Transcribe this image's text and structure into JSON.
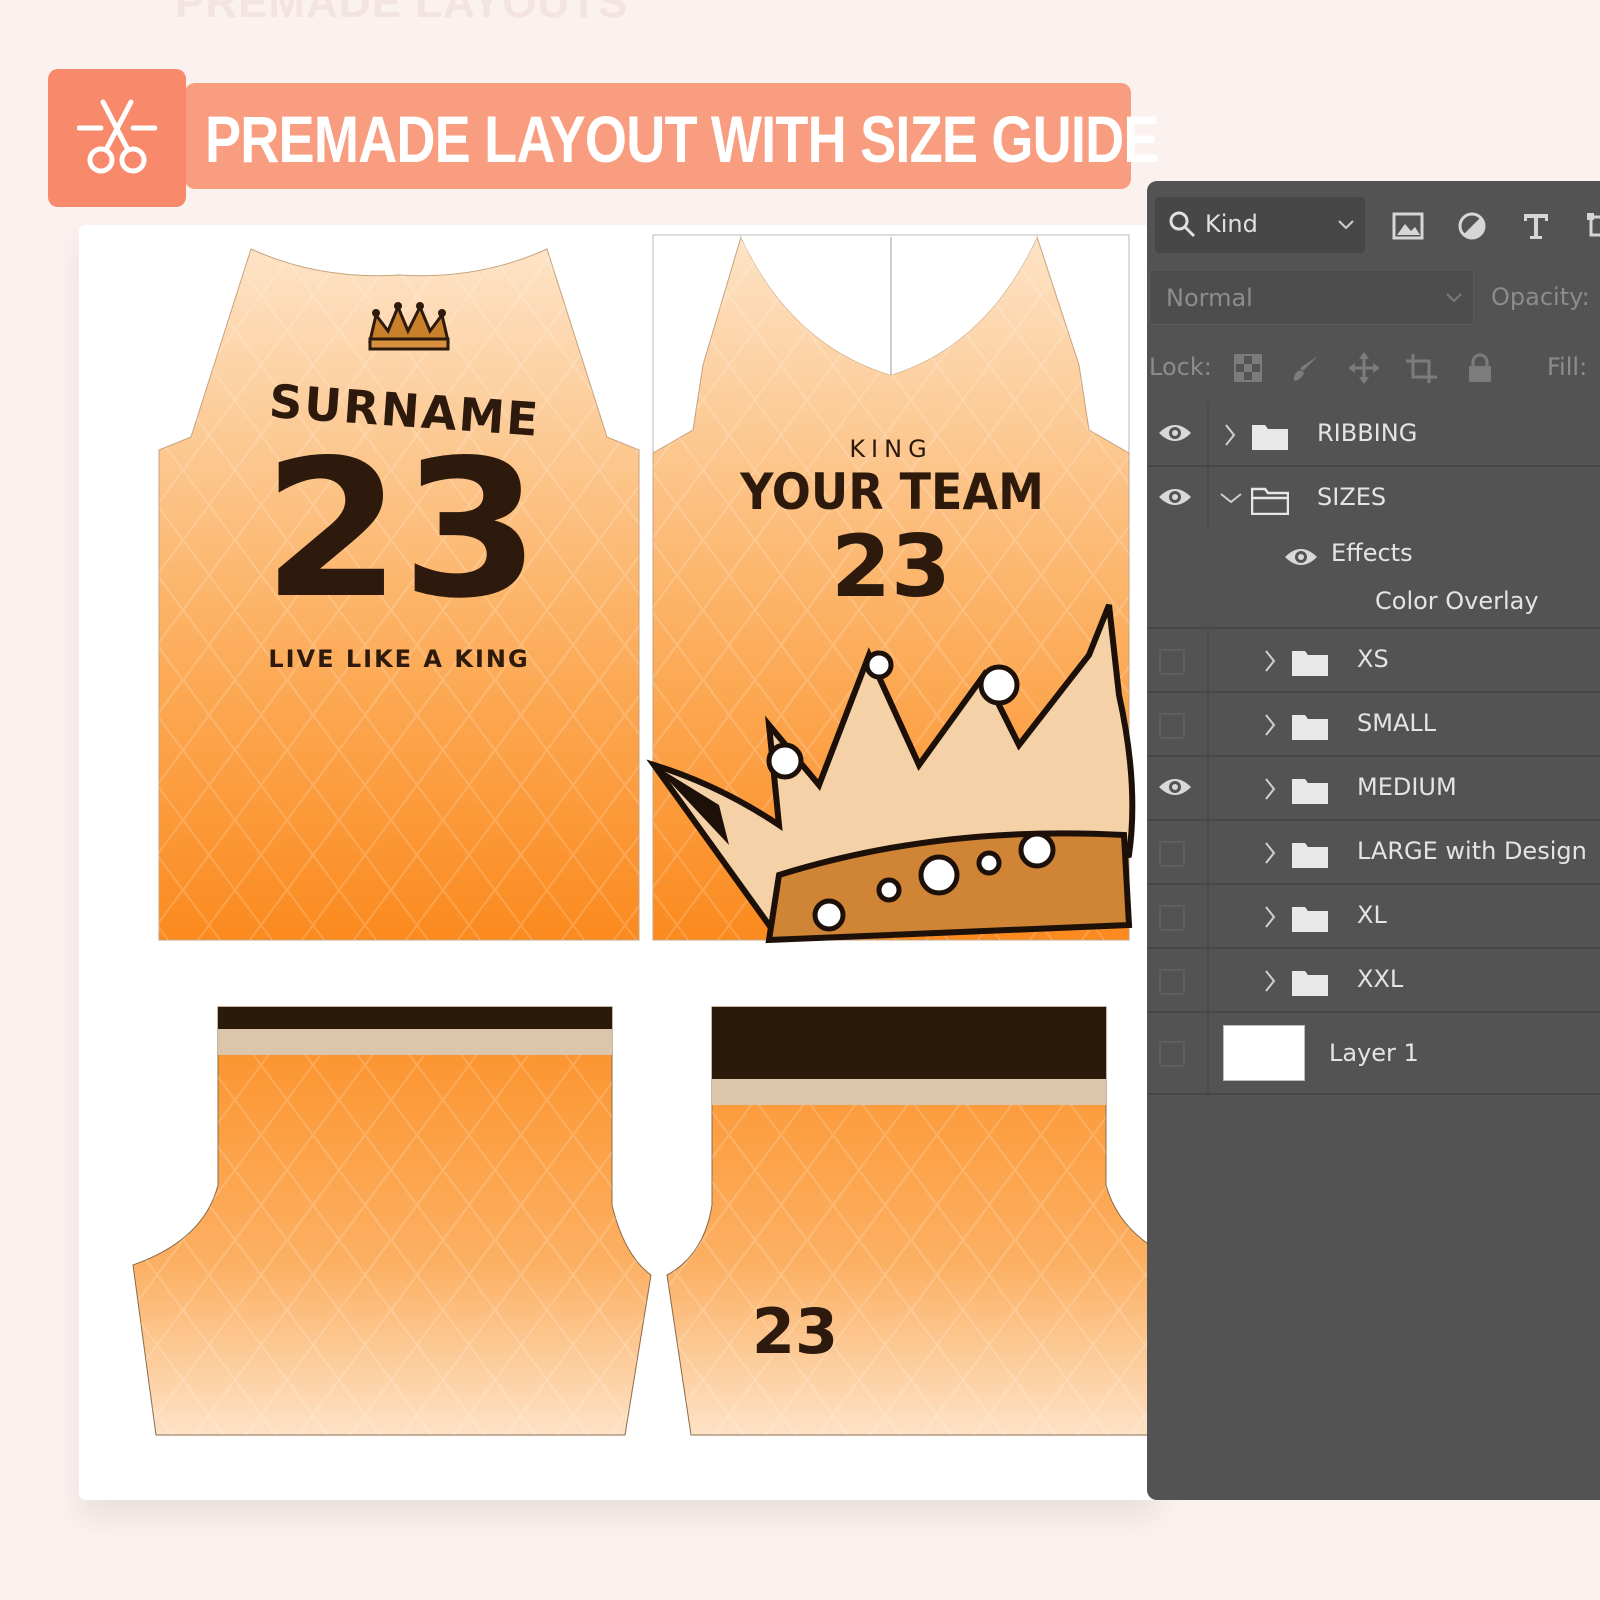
{
  "header": {
    "ghost_text": "PREMADE LAYOUTS",
    "banner_title": "PREMADE LAYOUT WITH SIZE GUIDE",
    "icon": "scissors-icon"
  },
  "colors": {
    "background": "#fbf1ef",
    "banner": "#f99d80",
    "banner_icon_box": "#f8896a",
    "jersey_light": "#fde3c6",
    "jersey_dark": "#fb8a1e",
    "brown": "#2d1a0c",
    "beige_stripe": "#dbc6ab",
    "panel": "#535353"
  },
  "jersey": {
    "back": {
      "surname": "SURNAME",
      "number": "23",
      "slogan": "LIVE LIKE A KING",
      "icon": "crown-icon"
    },
    "front": {
      "top_text": "KING",
      "team": "YOUR TEAM",
      "number": "23",
      "icon": "crown-icon"
    },
    "shorts": {
      "number": "23"
    }
  },
  "layers_panel": {
    "filter": {
      "kind_label": "Kind",
      "icons": [
        "image-filter-icon",
        "adjustment-filter-icon",
        "type-filter-icon",
        "shape-filter-icon"
      ]
    },
    "blend_mode": "Normal",
    "opacity_label": "Opacity:",
    "lock_label": "Lock:",
    "lock_icons": [
      "lock-transparent-icon",
      "lock-image-icon",
      "lock-position-icon",
      "lock-artboard-icon",
      "lock-all-icon"
    ],
    "fill_label": "Fill:",
    "layers": [
      {
        "name": "RIBBING",
        "visible": true,
        "expanded": false,
        "indent": 0,
        "type": "group"
      },
      {
        "name": "SIZES",
        "visible": true,
        "expanded": true,
        "indent": 0,
        "type": "group"
      },
      {
        "name": "XS",
        "visible": false,
        "expanded": false,
        "indent": 1,
        "type": "group"
      },
      {
        "name": "SMALL",
        "visible": false,
        "expanded": false,
        "indent": 1,
        "type": "group"
      },
      {
        "name": "MEDIUM",
        "visible": true,
        "expanded": false,
        "indent": 1,
        "type": "group"
      },
      {
        "name": "LARGE with Design",
        "visible": false,
        "expanded": false,
        "indent": 1,
        "type": "group"
      },
      {
        "name": "XL",
        "visible": false,
        "expanded": false,
        "indent": 1,
        "type": "group"
      },
      {
        "name": "XXL",
        "visible": false,
        "expanded": false,
        "indent": 1,
        "type": "group"
      },
      {
        "name": "Layer 1",
        "visible": false,
        "type": "layer"
      }
    ],
    "effects_label": "Effects",
    "color_overlay_label": "Color Overlay"
  }
}
